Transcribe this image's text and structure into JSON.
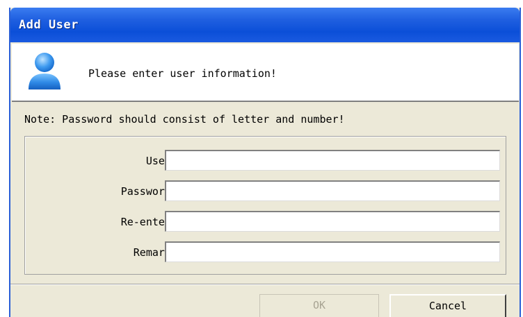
{
  "dialog": {
    "title": "Add User",
    "header_message": "Please enter user information!",
    "note": "Note: Password should consist of letter and number!",
    "fields": [
      {
        "label": "User:",
        "value": "",
        "placeholder": ""
      },
      {
        "label": "Password:",
        "value": "",
        "placeholder": ""
      },
      {
        "label": "Re-enter:",
        "value": "",
        "placeholder": ""
      },
      {
        "label": "Remark:",
        "value": "",
        "placeholder": ""
      }
    ],
    "buttons": {
      "ok_label": "OK",
      "ok_enabled": false,
      "cancel_label": "Cancel"
    },
    "icons": {
      "header": "user-icon"
    },
    "colors": {
      "titlebar": "#0b4fd8",
      "dialog_bg": "#ece9d8",
      "header_bg": "#ffffff",
      "disabled_text": "#a8a493"
    }
  }
}
